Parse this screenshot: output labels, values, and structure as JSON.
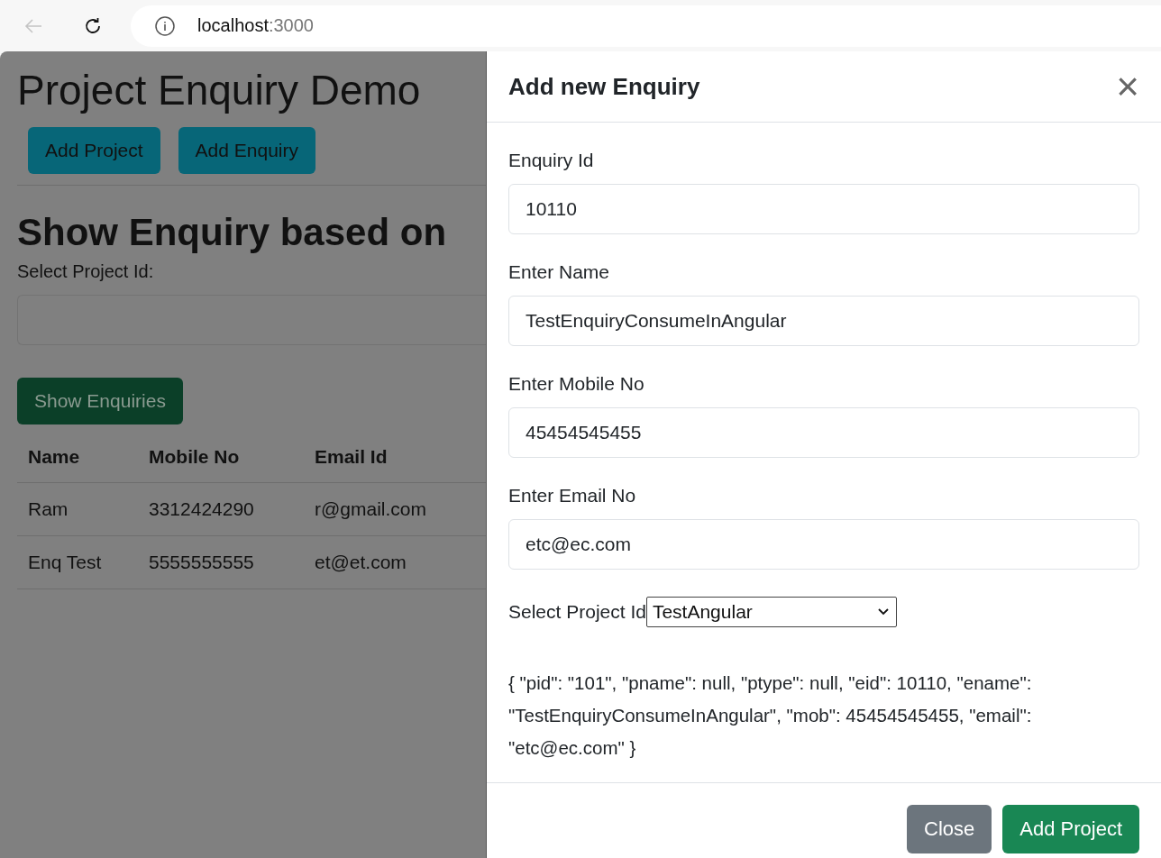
{
  "browser": {
    "url_host": "localhost",
    "url_port": ":3000"
  },
  "page": {
    "title": "Project Enquiry Demo",
    "buttons": [
      "Add Project",
      "Add Enquiry"
    ],
    "section_title": "Show Enquiry based on",
    "select_label": "Select Project Id:",
    "show_button": "Show Enquiries",
    "table": {
      "columns": [
        "Name",
        "Mobile No",
        "Email Id"
      ],
      "rows": [
        {
          "cells": [
            "Ram",
            "3312424290",
            "r@gmail.com"
          ]
        },
        {
          "cells": [
            "Enq Test",
            "5555555555",
            "et@et.com"
          ]
        }
      ]
    }
  },
  "modal": {
    "title": "Add new Enquiry",
    "close_icon": "×",
    "fields": [
      {
        "label": "Enquiry Id",
        "value": "10110"
      },
      {
        "label": "Enter Name",
        "value": "TestEnquiryConsumeInAngular"
      },
      {
        "label": "Enter Mobile No",
        "value": "45454545455"
      },
      {
        "label": "Enter Email No",
        "value": "etc@ec.com"
      }
    ],
    "select_label": "Select Project Id",
    "select_value": "TestAngular",
    "json_preview": "{ \"pid\": \"101\", \"pname\": null, \"ptype\": null, \"eid\": 10110, \"ename\": \"TestEnquiryConsumeInAngular\", \"mob\": 45454545455, \"email\": \"etc@ec.com\" }",
    "footer_buttons": [
      {
        "label": "Close",
        "kind": "secondary"
      },
      {
        "label": "Add Project",
        "kind": "primary"
      }
    ]
  }
}
